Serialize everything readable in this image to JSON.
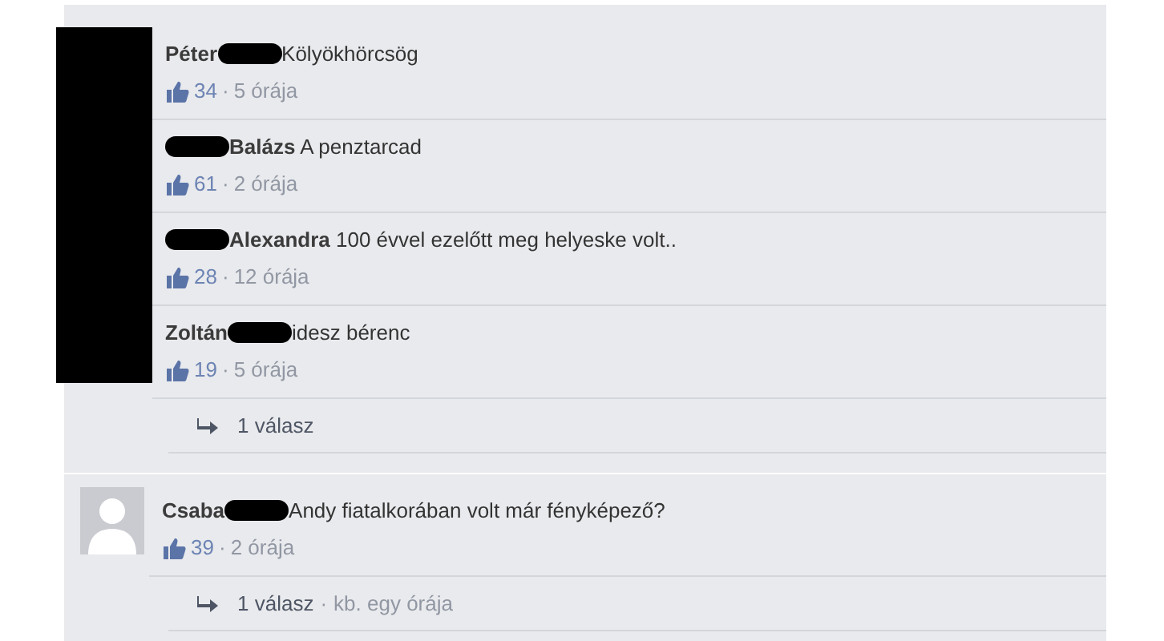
{
  "blocks": [
    {
      "kind": "redacted_group",
      "comments": [
        {
          "segments": [
            {
              "kind": "name",
              "text": "Péter"
            },
            {
              "kind": "redacted"
            },
            {
              "kind": "text",
              "text": "Kölyökhörcsög"
            }
          ],
          "likes": "34",
          "sep": "·",
          "time": "5 órája"
        },
        {
          "segments": [
            {
              "kind": "redacted"
            },
            {
              "kind": "name",
              "text": "Balázs"
            },
            {
              "kind": "text",
              "text": " A penztarcad"
            }
          ],
          "likes": "61",
          "sep": "·",
          "time": "2 órája"
        },
        {
          "segments": [
            {
              "kind": "redacted"
            },
            {
              "kind": "name",
              "text": "Alexandra"
            },
            {
              "kind": "text",
              "text": " 100 évvel ezelőtt meg helyeske volt.."
            }
          ],
          "likes": "28",
          "sep": "·",
          "time": "12 órája"
        },
        {
          "segments": [
            {
              "kind": "name",
              "text": "Zoltán"
            },
            {
              "kind": "redacted"
            },
            {
              "kind": "text",
              "text": "idesz bérenc"
            }
          ],
          "likes": "19",
          "sep": "·",
          "time": "5 órája"
        }
      ]
    },
    {
      "kind": "replies",
      "label": "1 válasz"
    },
    {
      "kind": "comment",
      "segments": [
        {
          "kind": "name",
          "text": "Csaba"
        },
        {
          "kind": "redacted"
        },
        {
          "kind": "text",
          "text": "Andy fiatalkorában volt már fényképező?"
        }
      ],
      "likes": "39",
      "sep": "·",
      "time": "2 órája"
    },
    {
      "kind": "replies",
      "label": "1 válasz",
      "sep": "·",
      "time": "kb. egy órája"
    }
  ]
}
